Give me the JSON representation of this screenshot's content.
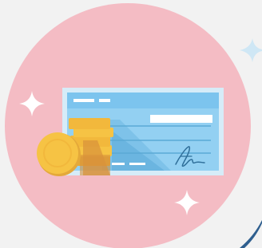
{
  "illustration": {
    "subject": "cheque-with-coins",
    "icons": [
      "sparkle-icon",
      "cheque-icon",
      "coin-stack-icon",
      "signature-icon"
    ]
  },
  "colors": {
    "background": "#f2f2f2",
    "circle": "#f4bcc4",
    "cheque_border": "#d6ecf8",
    "cheque_body": "#93d0f2",
    "cheque_header": "#7cc4ee",
    "cheque_shadow": "#5ba9d6",
    "text_line": "#ffffff",
    "coin_gold": "#f6c344",
    "coin_dark": "#e4a93a",
    "coin_shadow": "#d9923a",
    "sparkle_white": "#ffffff",
    "sparkle_blue": "#cfe7f5",
    "corner_arc": "#2f5f8f"
  }
}
